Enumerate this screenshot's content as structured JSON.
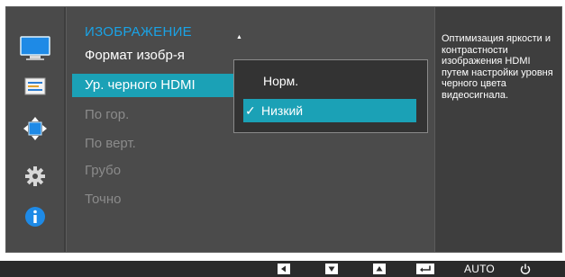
{
  "sidebar": {
    "icons": [
      {
        "name": "picture-icon",
        "active": true
      },
      {
        "name": "onscreen-display-icon",
        "active": false
      },
      {
        "name": "position-icon",
        "active": false
      },
      {
        "name": "settings-icon",
        "active": false
      },
      {
        "name": "information-icon",
        "active": false
      }
    ]
  },
  "menu": {
    "title": "ИЗОБРАЖЕНИЕ",
    "items": [
      {
        "label": "Формат изобр-я",
        "state": "normal"
      },
      {
        "label": "Ур. черного HDMI",
        "state": "selected"
      },
      {
        "label": "По гор.",
        "state": "disabled"
      },
      {
        "label": "По верт.",
        "state": "disabled"
      },
      {
        "label": "Грубо",
        "state": "disabled"
      },
      {
        "label": "Точно",
        "state": "disabled"
      }
    ]
  },
  "submenu": {
    "options": [
      {
        "label": "Норм.",
        "checked": false
      },
      {
        "label": "Низкий",
        "checked": true
      }
    ]
  },
  "description": "Оптимизация яркости и контрастности изображения HDMI путем настройки уровня черного цвета видеосигнала.",
  "bottom_bar": {
    "auto_label": "AUTO",
    "keys": [
      "left-key-icon",
      "down-key-icon",
      "up-key-icon",
      "enter-key-icon",
      "auto",
      "power-icon"
    ]
  },
  "colors": {
    "accent": "#1ba1b6",
    "title": "#1aa3e6",
    "background": "#3e3e3e"
  }
}
